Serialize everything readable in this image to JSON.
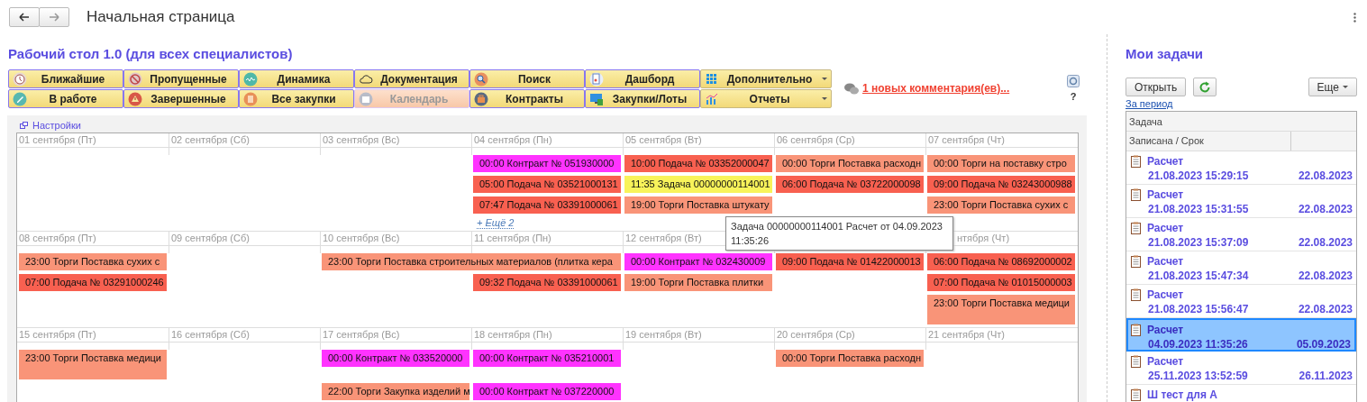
{
  "window": {
    "title": "Начальная страница"
  },
  "workspace": {
    "title": "Рабочий стол 1.0 (для всех специалистов)",
    "toolbar": [
      [
        {
          "label": "Ближайшие",
          "kind": "clock",
          "disabled": false,
          "dropdown": false
        },
        {
          "label": "Пропущенные",
          "kind": "forbidden",
          "disabled": false,
          "dropdown": false
        },
        {
          "label": "Динамика",
          "kind": "wave",
          "disabled": false,
          "dropdown": false
        },
        {
          "label": "Документация",
          "kind": "cloud",
          "disabled": false,
          "dropdown": false
        },
        {
          "label": "Поиск",
          "kind": "search",
          "disabled": false,
          "dropdown": false
        },
        {
          "label": "Дашборд",
          "kind": "report",
          "disabled": false,
          "dropdown": false
        },
        {
          "label": "Дополнительно",
          "kind": "grid",
          "disabled": false,
          "dropdown": true
        }
      ],
      [
        {
          "label": "В работе",
          "kind": "pencil",
          "disabled": false,
          "dropdown": false
        },
        {
          "label": "Завершенные",
          "kind": "warning",
          "disabled": false,
          "dropdown": false
        },
        {
          "label": "Все закупки",
          "kind": "document",
          "disabled": false,
          "dropdown": false
        },
        {
          "label": "Календарь",
          "kind": "calendar",
          "disabled": true,
          "dropdown": false
        },
        {
          "label": "Контракты",
          "kind": "briefcase",
          "disabled": false,
          "dropdown": false
        },
        {
          "label": "Закупки/Лоты",
          "kind": "monitor",
          "disabled": false,
          "dropdown": false
        },
        {
          "label": "Отчеты",
          "kind": "bars",
          "disabled": false,
          "dropdown": true
        }
      ]
    ],
    "comments_link": "1 новых комментария(ев)...",
    "help": "?"
  },
  "calendar": {
    "settings_link": "Настройки",
    "weeks": [
      {
        "days": [
          {
            "date": "01 сентября (Пт)"
          },
          {
            "date": "02 сентября (Сб)"
          },
          {
            "date": "03 сентября (Вс)"
          },
          {
            "date": "04 сентября (Пн)",
            "events": [
              {
                "text": "00:00 Контракт № 051930000",
                "color": "#ff33ff",
                "wide": false,
                "tall": false
              },
              {
                "text": "05:00 Подача № 03521000131",
                "color": "#f86050",
                "wide": false,
                "tall": false
              },
              {
                "text": "07:47 Подача № 03391000061",
                "color": "#f86050",
                "wide": false,
                "tall": false
              }
            ],
            "more": "+ Ещё 2"
          },
          {
            "date": "05 сентября (Вт)",
            "events": [
              {
                "text": "10:00 Подача № 03352000047",
                "color": "#f86050",
                "wide": false,
                "tall": false
              },
              {
                "text": "11:35 Задача 00000000114001",
                "color": "#f8f35a",
                "wide": false,
                "tall": false
              },
              {
                "text": "19:00 Торги Поставка штукату",
                "color": "#f99478",
                "wide": false,
                "tall": false
              }
            ]
          },
          {
            "date": "06 сентября (Ср)",
            "events": [
              {
                "text": "00:00 Торги Поставка расходн",
                "color": "#f99478",
                "wide": false,
                "tall": false
              },
              {
                "text": "06:00 Подача № 03722000098",
                "color": "#f86050",
                "wide": false,
                "tall": false
              }
            ]
          },
          {
            "date": "07 сентября (Чт)",
            "events": [
              {
                "text": "00:00 Торги на поставку стро",
                "color": "#f99478",
                "wide": false,
                "tall": false
              },
              {
                "text": "09:00 Подача № 03243000988",
                "color": "#f86050",
                "wide": false,
                "tall": false
              },
              {
                "text": "23:00 Торги Поставка сухих с",
                "color": "#f99478",
                "wide": false,
                "tall": false
              }
            ]
          }
        ]
      },
      {
        "days": [
          {
            "date": "08 сентября (Пт)",
            "events": [
              {
                "text": "23:00 Торги Поставка сухих с",
                "color": "#f99478",
                "wide": false,
                "tall": false
              },
              {
                "text": "07:00 Подача № 03291000246",
                "color": "#f86050",
                "wide": false,
                "tall": false
              }
            ]
          },
          {
            "date": "09 сентября (Сб)"
          },
          {
            "date": "10 сентября (Вс)",
            "events": [
              {
                "text": "23:00 Торги Поставка строительных материалов (плитка кера",
                "color": "#f99478",
                "wide": true,
                "tall": false
              }
            ]
          },
          {
            "date": "11 сентября (Пн)",
            "events": [
              {
                "text": "09:32 Подача № 03391000061",
                "color": "#f86050",
                "wide": false,
                "tall": false
              }
            ]
          },
          {
            "date": "12 сентября (Вт)",
            "events": [
              {
                "text": "00:00 Контракт № 032430009",
                "color": "#ff33ff",
                "wide": false,
                "tall": false
              },
              {
                "text": "19:00 Торги Поставка плитки",
                "color": "#f99478",
                "wide": false,
                "tall": false
              }
            ]
          },
          {
            "events": [
              {
                "text": "09:00 Подача № 01422000013",
                "color": "#f86050",
                "wide": false,
                "tall": false
              }
            ]
          },
          {
            "date": "нтября (Чт)",
            "partly_covered": true,
            "events": [
              {
                "text": "06:00 Подача № 08692000002",
                "color": "#f86050",
                "wide": false,
                "tall": false
              },
              {
                "text": "07:00 Подача № 01015000003",
                "color": "#f86050",
                "wide": false,
                "tall": false
              },
              {
                "text": "23:00 Торги Поставка медици",
                "color": "#f99478",
                "wide": false,
                "tall": true
              }
            ]
          }
        ]
      },
      {
        "days": [
          {
            "date": "15 сентября (Пт)",
            "events": [
              {
                "text": "23:00 Торги Поставка медици",
                "color": "#f99478",
                "wide": false,
                "tall": true
              }
            ]
          },
          {
            "date": "16 сентября (Сб)"
          },
          {
            "date": "17 сентября (Вс)",
            "events": [
              {
                "text": "00:00 Контракт № 033520000",
                "color": "#ff33ff",
                "wide": false,
                "tall": false
              },
              {
                "text": "22:00 Торги Закупка изделий м",
                "color": "#f99478",
                "wide": false,
                "tall": false
              }
            ]
          },
          {
            "date": "18 сентября (Пн)",
            "events": [
              {
                "text": "00:00 Контракт № 035210001",
                "color": "#ff33ff",
                "wide": false,
                "tall": false
              },
              {
                "text": "00:00 Контракт № 037220000",
                "color": "#ff33ff",
                "wide": false,
                "tall": false
              }
            ]
          },
          {
            "date": "19 сентября (Вт)"
          },
          {
            "date": "20 сентября (Ср)",
            "events": [
              {
                "text": "00:00 Торги Поставка расходн",
                "color": "#f99478",
                "wide": false,
                "tall": false
              }
            ]
          },
          {
            "date": "21 сентября (Чт)"
          }
        ]
      }
    ],
    "tooltip": "Задача  00000000114001 Расчет от 04.09.2023 11:35:26"
  },
  "tasks": {
    "title": "Мои задачи",
    "open_button": "Открыть",
    "more_button": "Еще",
    "period_link": "За период",
    "columns": [
      "Задача",
      "Записана / Срок"
    ],
    "rows": [
      {
        "title": "Расчет",
        "created": "21.08.2023 15:29:15",
        "due": "22.08.2023",
        "selected": false
      },
      {
        "title": "Расчет",
        "created": "21.08.2023 15:31:55",
        "due": "22.08.2023",
        "selected": false
      },
      {
        "title": "Расчет",
        "created": "21.08.2023 15:37:09",
        "due": "22.08.2023",
        "selected": false
      },
      {
        "title": "Расчет",
        "created": "21.08.2023 15:47:34",
        "due": "22.08.2023",
        "selected": false
      },
      {
        "title": "Расчет",
        "created": "21.08.2023 15:56:47",
        "due": "22.08.2023",
        "selected": false
      },
      {
        "title": "Расчет",
        "created": "04.09.2023 11:35:26",
        "due": "05.09.2023",
        "selected": true
      },
      {
        "title": "Расчет",
        "created": "25.11.2023 13:52:59",
        "due": "26.11.2023",
        "selected": false
      },
      {
        "title": "Ш тест для А",
        "selected": false
      }
    ]
  }
}
